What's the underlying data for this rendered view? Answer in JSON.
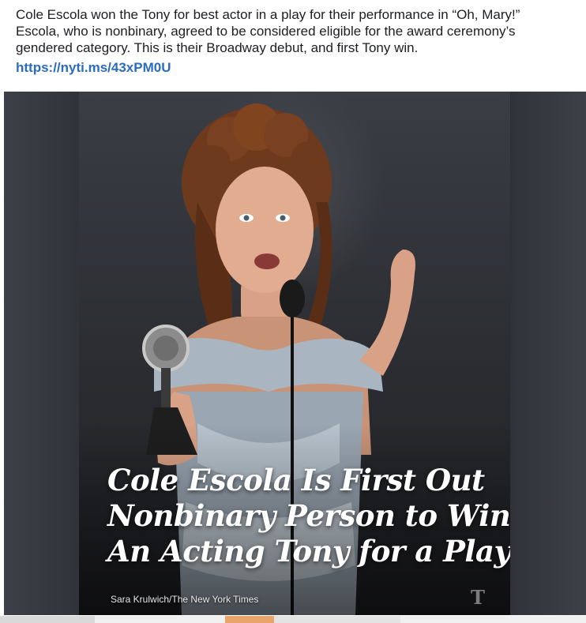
{
  "post": {
    "text_lines": [
      "Cole Escola won the Tony for best actor in a play for their performance in “Oh, Mary!”",
      "Escola, who is nonbinary, agreed to be considered eligible for the award ceremony’s",
      "gendered category. This is their Broadway debut, and first Tony win."
    ],
    "link": "https://nyti.ms/43xPM0U",
    "link_color": "#2a6cc0"
  },
  "photo": {
    "headline_lines": [
      "Cole Escola Is First Out",
      "Nonbinary Person to Win",
      "An Acting Tony for a Play"
    ],
    "credit": "Sara Krulwich/The New York Times",
    "logo_glyph": "𝕱",
    "logo_name": "nyt-logo"
  },
  "colors": {
    "text": "#1c1e21",
    "headline": "#ffffff",
    "photo_background": "#2b2f36"
  }
}
